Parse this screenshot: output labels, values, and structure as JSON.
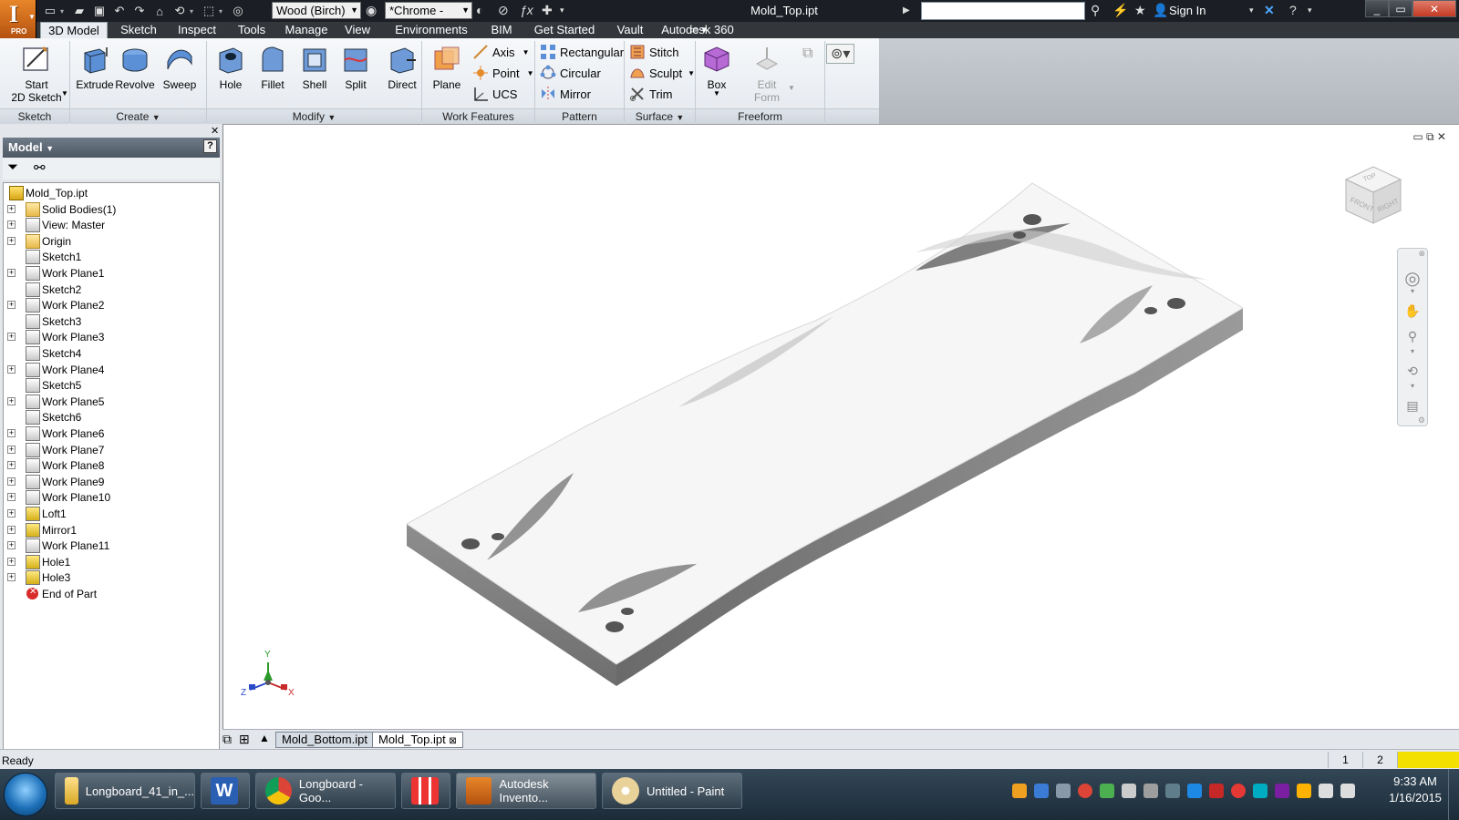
{
  "app": {
    "title": "Mold_Top.ipt",
    "material": "Wood (Birch)",
    "appearance": "*Chrome -",
    "sign_in": "Sign In",
    "logo_label": "PRO"
  },
  "menu": {
    "tabs": [
      "3D Model",
      "Sketch",
      "Inspect",
      "Tools",
      "Manage",
      "View",
      "Environments",
      "BIM",
      "Get Started",
      "Vault",
      "Autodesk 360"
    ],
    "active": "3D Model"
  },
  "ribbon": {
    "sketch": {
      "start_line1": "Start",
      "start_line2": "2D Sketch",
      "panel": "Sketch"
    },
    "create": {
      "extrude": "Extrude",
      "revolve": "Revolve",
      "sweep": "Sweep",
      "panel": "Create"
    },
    "modify": {
      "hole": "Hole",
      "fillet": "Fillet",
      "shell": "Shell",
      "split": "Split",
      "direct": "Direct",
      "panel": "Modify"
    },
    "work_features": {
      "plane": "Plane",
      "axis": "Axis",
      "point": "Point",
      "ucs": "UCS",
      "panel": "Work Features"
    },
    "pattern": {
      "rectangular": "Rectangular",
      "circular": "Circular",
      "mirror": "Mirror",
      "panel": "Pattern"
    },
    "surface": {
      "stitch": "Stitch",
      "sculpt": "Sculpt",
      "trim": "Trim",
      "panel": "Surface"
    },
    "freeform": {
      "box": "Box",
      "edit_line1": "Edit",
      "edit_line2": "Form",
      "panel": "Freeform"
    }
  },
  "browser": {
    "title": "Model",
    "help": "?",
    "nodes": [
      {
        "label": "Mold_Top.ipt",
        "icon": "part",
        "expander": false
      },
      {
        "label": "Solid Bodies(1)",
        "icon": "folder",
        "expander": true
      },
      {
        "label": "View: Master",
        "icon": "view",
        "expander": true
      },
      {
        "label": "Origin",
        "icon": "folder",
        "expander": true
      },
      {
        "label": "Sketch1",
        "icon": "sketch",
        "expander": false
      },
      {
        "label": "Work Plane1",
        "icon": "plane",
        "expander": true
      },
      {
        "label": "Sketch2",
        "icon": "sketch",
        "expander": false
      },
      {
        "label": "Work Plane2",
        "icon": "plane",
        "expander": true
      },
      {
        "label": "Sketch3",
        "icon": "sketch",
        "expander": false
      },
      {
        "label": "Work Plane3",
        "icon": "plane",
        "expander": true
      },
      {
        "label": "Sketch4",
        "icon": "sketch",
        "expander": false
      },
      {
        "label": "Work Plane4",
        "icon": "plane",
        "expander": true
      },
      {
        "label": "Sketch5",
        "icon": "sketch",
        "expander": false
      },
      {
        "label": "Work Plane5",
        "icon": "plane",
        "expander": true
      },
      {
        "label": "Sketch6",
        "icon": "sketch",
        "expander": false
      },
      {
        "label": "Work Plane6",
        "icon": "plane",
        "expander": true
      },
      {
        "label": "Work Plane7",
        "icon": "plane",
        "expander": true
      },
      {
        "label": "Work Plane8",
        "icon": "plane",
        "expander": true
      },
      {
        "label": "Work Plane9",
        "icon": "plane",
        "expander": true
      },
      {
        "label": "Work Plane10",
        "icon": "plane",
        "expander": true
      },
      {
        "label": "Loft1",
        "icon": "loft",
        "expander": true
      },
      {
        "label": "Mirror1",
        "icon": "mirror",
        "expander": true
      },
      {
        "label": "Work Plane11",
        "icon": "plane",
        "expander": true
      },
      {
        "label": "Hole1",
        "icon": "hole",
        "expander": true
      },
      {
        "label": "Hole3",
        "icon": "hole",
        "expander": true
      },
      {
        "label": "End of Part",
        "icon": "end",
        "expander": false
      }
    ]
  },
  "viewcube": {
    "top": "TOP",
    "front": "FRONT",
    "right": "RIGHT"
  },
  "triad": {
    "x": "X",
    "y": "Y",
    "z": "Z"
  },
  "doc_tabs": [
    "Mold_Bottom.ipt",
    "Mold_Top.ipt"
  ],
  "active_doc": "Mold_Top.ipt",
  "status": {
    "text": "Ready",
    "cell1": "1",
    "cell2": "2"
  },
  "taskbar": {
    "items": [
      "Longboard_41_in_...",
      "Longboard - Goo...",
      "Autodesk Invento...",
      "Untitled - Paint"
    ],
    "time": "9:33 AM",
    "date": "1/16/2015"
  },
  "colors": {
    "titlebar": "#1b1f25",
    "menubar": "#33373c",
    "accent_orange": "#e8862a",
    "status_yellow": "#f3e000"
  }
}
